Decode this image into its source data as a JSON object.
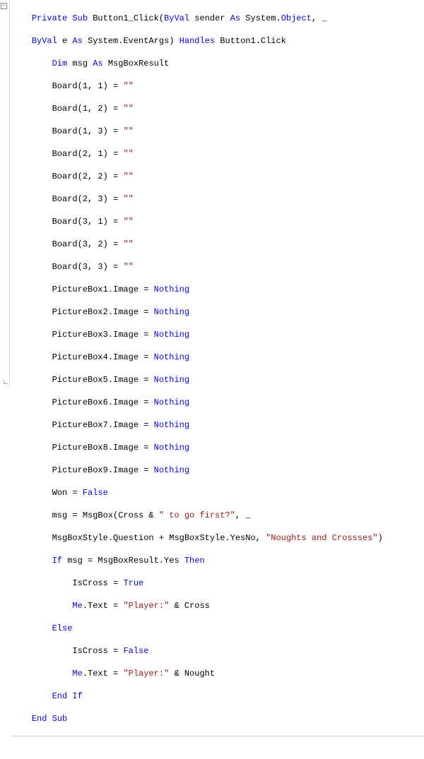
{
  "indent1": "    ",
  "indent2": "        ",
  "indent3": "            ",
  "sig1_a": "Private Sub",
  "sig1_b": " Button1_Click(",
  "sig1_c": "ByVal",
  "sig1_d": " sender ",
  "sig1_e": "As",
  "sig1_f": " System.",
  "sig1_g": "Object",
  "sig1_h": ", _",
  "sig2_a": "ByVal",
  "sig2_b": " e ",
  "sig2_c": "As",
  "sig2_d": " System.EventArgs) ",
  "sig2_e": "Handles",
  "sig2_f": " Button1.Click",
  "dim_a": "Dim",
  "dim_b": " msg ",
  "dim_c": "As",
  "dim_d": " MsgBoxResult",
  "board11_a": "Board(1, 1) = ",
  "empty_str": "\"\"",
  "board12_a": "Board(1, 2) = ",
  "board13_a": "Board(1, 3) = ",
  "board21_a": "Board(2, 1) = ",
  "board22_a": "Board(2, 2) = ",
  "board23_a": "Board(2, 3) = ",
  "board31_a": "Board(3, 1) = ",
  "board32_a": "Board(3, 2) = ",
  "board33_a": "Board(3, 3) = ",
  "pb1_a": "PictureBox1.Image = ",
  "nothing_kw": "Nothing",
  "pb2_a": "PictureBox2.Image = ",
  "pb3_a": "PictureBox3.Image = ",
  "pb4_a": "PictureBox4.Image = ",
  "pb5_a": "PictureBox5.Image = ",
  "pb6_a": "PictureBox6.Image = ",
  "pb7_a": "PictureBox7.Image = ",
  "pb8_a": "PictureBox8.Image = ",
  "pb9_a": "PictureBox9.Image = ",
  "won_a": "Won = ",
  "false_kw": "False",
  "msgbox_a": "msg = MsgBox(Cross & ",
  "msgbox_b": "\" to go first?\"",
  "msgbox_c": ", _",
  "msgbox2_a": "MsgBoxStyle.Question + MsgBoxStyle.YesNo, ",
  "msgbox2_b": "\"Noughts and Crossses\"",
  "msgbox2_c": ")",
  "if_a": "If",
  "if_b": " msg = MsgBoxResult.Yes ",
  "if_c": "Then",
  "iscross_a": "IsCross = ",
  "true_kw": "True",
  "me_kw": "Me",
  "metext_a": ".Text = ",
  "player_str": "\"Player:\"",
  "metext_c": " & Cross",
  "else_kw": "Else",
  "metext2_c": " & Nought",
  "endif_kw": "End If",
  "endsub_kw": "End Sub",
  "collapse_glyph": "−"
}
